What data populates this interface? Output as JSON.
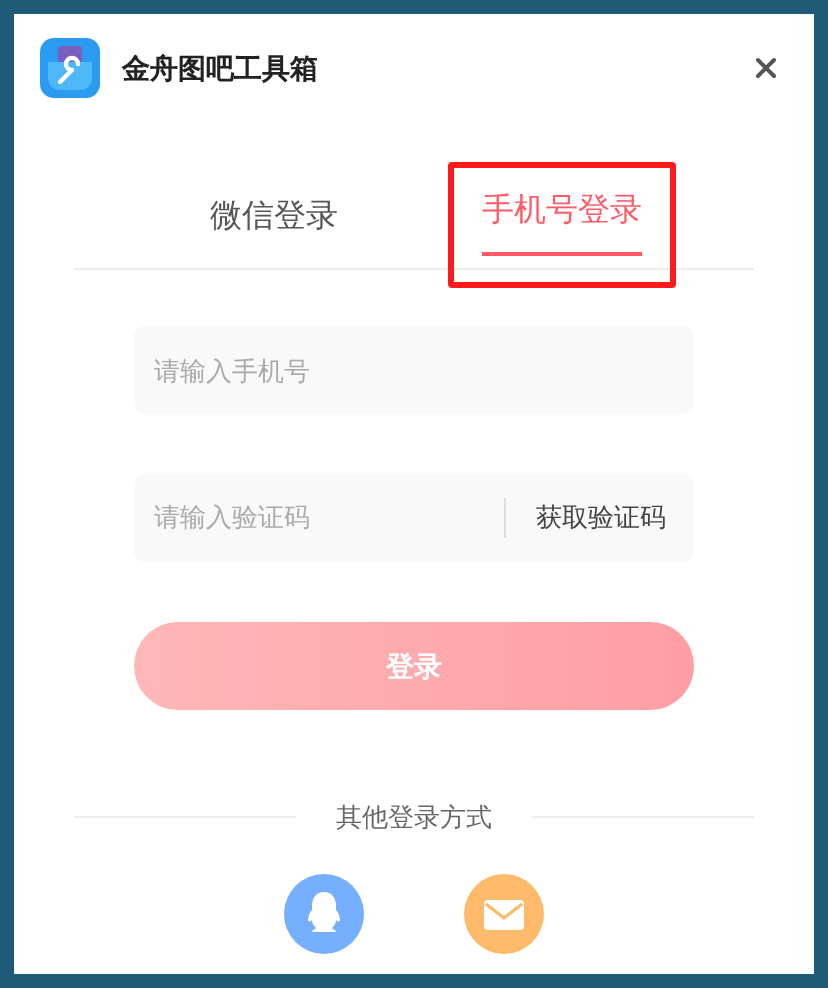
{
  "window": {
    "title": "金舟图吧工具箱"
  },
  "tabs": [
    {
      "label": "微信登录",
      "selected": false,
      "highlighted": false
    },
    {
      "label": "手机号登录",
      "selected": true,
      "highlighted": true
    }
  ],
  "phone_field": {
    "placeholder": "请输入手机号"
  },
  "code_field": {
    "placeholder": "请输入验证码"
  },
  "get_code_button": "获取验证码",
  "login_button": "登录",
  "other_login": {
    "label": "其他登录方式",
    "methods": [
      {
        "kind": "qq",
        "color": "#75aefc"
      },
      {
        "kind": "mail",
        "color": "#ffbb6b"
      }
    ]
  }
}
